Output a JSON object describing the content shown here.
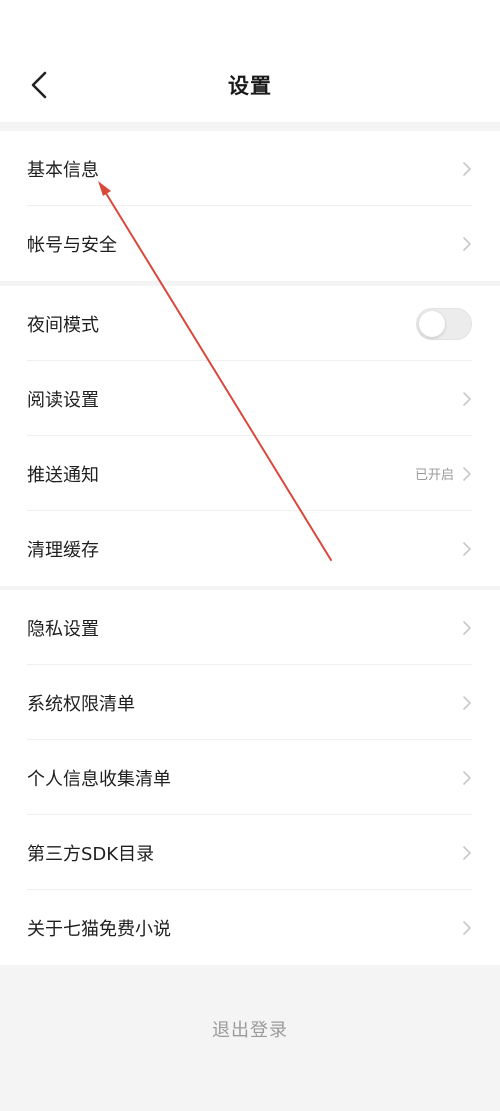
{
  "header": {
    "title": "设置",
    "back_icon": "chevron-left-icon"
  },
  "group1": {
    "items": [
      {
        "label": "基本信息"
      },
      {
        "label": "帐号与安全"
      }
    ]
  },
  "group2": {
    "items": [
      {
        "label": "夜间模式",
        "toggle_on": false
      },
      {
        "label": "阅读设置"
      },
      {
        "label": "推送通知",
        "value": "已开启"
      },
      {
        "label": "清理缓存"
      }
    ]
  },
  "group3": {
    "items": [
      {
        "label": "隐私设置"
      },
      {
        "label": "系统权限清单"
      },
      {
        "label": "个人信息收集清单"
      },
      {
        "label": "第三方SDK目录"
      },
      {
        "label": "关于七猫免费小说"
      }
    ]
  },
  "footer": {
    "logout_label": "退出登录"
  },
  "colors": {
    "annotation_arrow": "#d9483b",
    "chevron": "#c8c8c8",
    "background": "#f4f4f4"
  }
}
